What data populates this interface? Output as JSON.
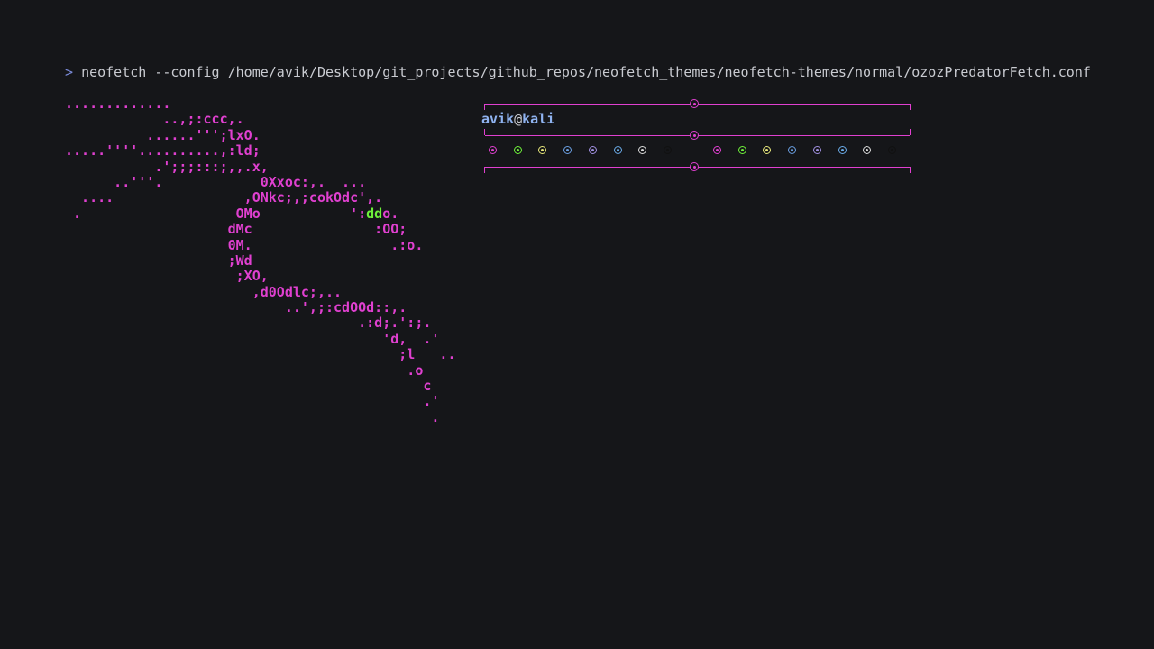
{
  "terminal": {
    "prompt_symbol": ">",
    "command": "neofetch --config /home/avik/Desktop/git_projects/github_repos/neofetch_themes/neofetch-themes/normal/ozozPredatorFetch.conf"
  },
  "ascii_art": {
    "color": "#e040d0",
    "highlight_color": "#6ef03a",
    "lines": [
      {
        "pre": ".............",
        "hl": "",
        "post": ""
      },
      {
        "pre": "            ..,;:ccc,.",
        "hl": "",
        "post": ""
      },
      {
        "pre": "          ......''';lxO.",
        "hl": "",
        "post": ""
      },
      {
        "pre": ".....''''..........,:ld;",
        "hl": "",
        "post": ""
      },
      {
        "pre": "           .';;;:::;,,.x,",
        "hl": "",
        "post": ""
      },
      {
        "pre": "      ..'''.            0Xxoc:,.  ...",
        "hl": "",
        "post": ""
      },
      {
        "pre": "  ....                ,ONkc;,;cokOdc',.",
        "hl": "",
        "post": ""
      },
      {
        "pre": " .                   OMo           ':",
        "hl": "dd",
        "post": "o."
      },
      {
        "pre": "                    dMc               :OO;",
        "hl": "",
        "post": ""
      },
      {
        "pre": "                    0M.                 .:o.",
        "hl": "",
        "post": ""
      },
      {
        "pre": "                    ;Wd",
        "hl": "",
        "post": ""
      },
      {
        "pre": "                     ;XO,",
        "hl": "",
        "post": ""
      },
      {
        "pre": "                       ,d0Odlc;,..",
        "hl": "",
        "post": ""
      },
      {
        "pre": "                           ..',;:cdOOd::,.",
        "hl": "",
        "post": ""
      },
      {
        "pre": "                                    .:d;.':;.",
        "hl": "",
        "post": ""
      },
      {
        "pre": "                                       'd,  .'",
        "hl": "",
        "post": ""
      },
      {
        "pre": "                                         ;l   ..",
        "hl": "",
        "post": ""
      },
      {
        "pre": "                                          .o",
        "hl": "",
        "post": ""
      },
      {
        "pre": "                                            c",
        "hl": "",
        "post": ""
      },
      {
        "pre": "                                            .'",
        "hl": "",
        "post": ""
      },
      {
        "pre": "                                             .",
        "hl": "",
        "post": ""
      }
    ]
  },
  "info": {
    "user": "avik",
    "at": "@",
    "host": "kali",
    "border_color": "#e040d0",
    "palette": [
      "#e040d0",
      "#6ef03a",
      "#e6e67a",
      "#6a9ee0",
      "#a090e0",
      "#6aaae6",
      "#d8d8d8",
      "#111111",
      "#e040d0",
      "#6ef03a",
      "#e6e67a",
      "#6a9ee0",
      "#a090e0",
      "#6aaae6",
      "#d8d8d8",
      "#111111"
    ]
  }
}
